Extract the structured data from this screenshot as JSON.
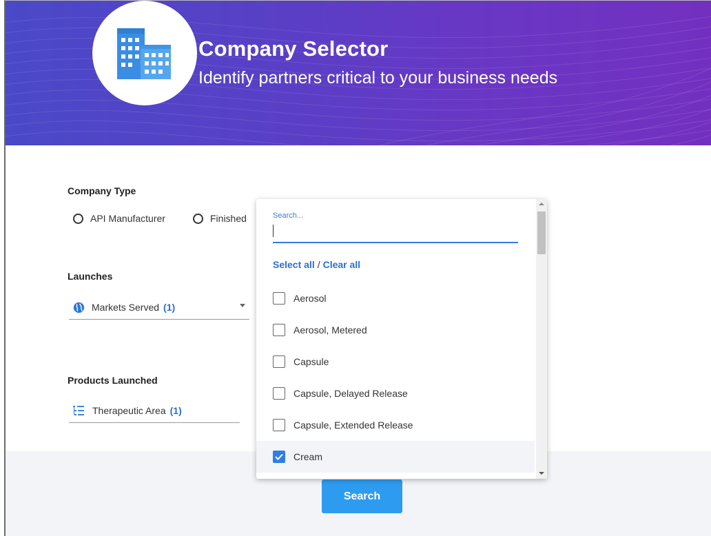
{
  "banner": {
    "title": "Company Selector",
    "subtitle": "Identify partners critical to your business needs"
  },
  "company_type": {
    "label": "Company Type",
    "options": [
      {
        "label": "API Manufacturer"
      },
      {
        "label": "Finished"
      }
    ]
  },
  "launches": {
    "label": "Launches",
    "filter": {
      "label": "Markets Served",
      "count": "(1)"
    }
  },
  "products_launched": {
    "label": "Products Launched",
    "filter": {
      "label": "Therapeutic Area",
      "count": "(1)"
    }
  },
  "dropdown": {
    "search_label": "Search...",
    "select_all": "Select all",
    "separator": "/",
    "clear_all": "Clear all",
    "items": [
      {
        "label": "Aerosol",
        "checked": false
      },
      {
        "label": "Aerosol, Metered",
        "checked": false
      },
      {
        "label": "Capsule",
        "checked": false
      },
      {
        "label": "Capsule, Delayed Release",
        "checked": false
      },
      {
        "label": "Capsule, Extended Release",
        "checked": false
      },
      {
        "label": "Cream",
        "checked": true
      }
    ]
  },
  "search_button": "Search",
  "colors": {
    "accent": "#2d9cf0",
    "link": "#2b6fd1",
    "banner_start": "#4a49c8",
    "banner_end": "#7330c0"
  }
}
